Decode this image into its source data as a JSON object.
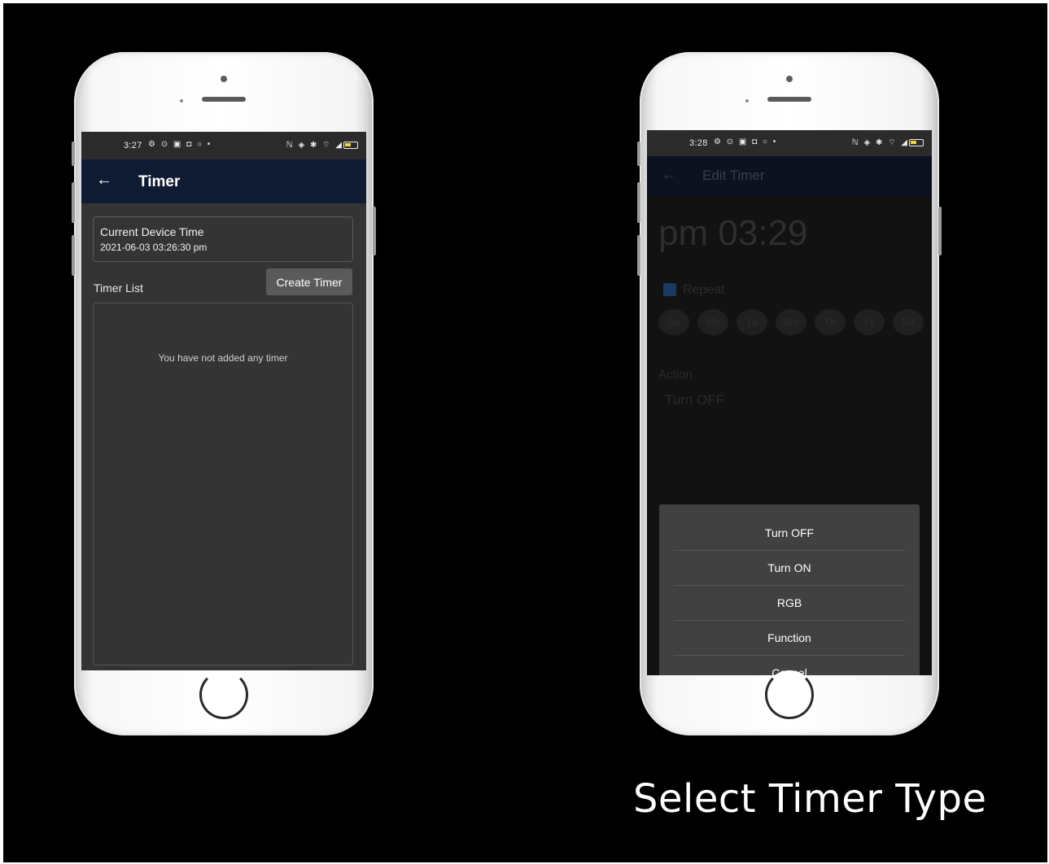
{
  "left_phone": {
    "status_time": "3:27",
    "status_icons_left": "⚙ ⊙ ▣ ◘ ○ •",
    "status_icons_right": "ℕ ◈ ✱ ⌔ ◢",
    "appbar": {
      "back_icon": "arrow-left",
      "title": "Timer"
    },
    "device_time": {
      "label": "Current Device Time",
      "value": "2021-06-03 03:26:30 pm"
    },
    "timer_list_label": "Timer List",
    "create_button": "Create Timer",
    "empty_message": "You have not added any timer"
  },
  "right_phone": {
    "status_time": "3:28",
    "status_icons_left": "⚙ ⊙ ▣ ◘ ○ •",
    "status_icons_right": "ℕ ◈ ✱ ⌔ ◢",
    "appbar": {
      "back_icon": "arrow-left",
      "title": "Edit Timer"
    },
    "time_display": "pm 03:29",
    "repeat_label": "Repeat",
    "days": [
      "Su",
      "Mo",
      "Tu",
      "We",
      "Th",
      "Fr",
      "Sa"
    ],
    "action_label": "Action",
    "action_value": "Turn OFF",
    "sheet_options": [
      "Turn OFF",
      "Turn ON",
      "RGB",
      "Function",
      "Cancel"
    ]
  },
  "caption": "Select Timer Type",
  "colors": {
    "appbar_bg": "#0f1a33",
    "content_bg": "#343434",
    "button_bg": "#5a5a5a",
    "sheet_bg": "#414141"
  }
}
